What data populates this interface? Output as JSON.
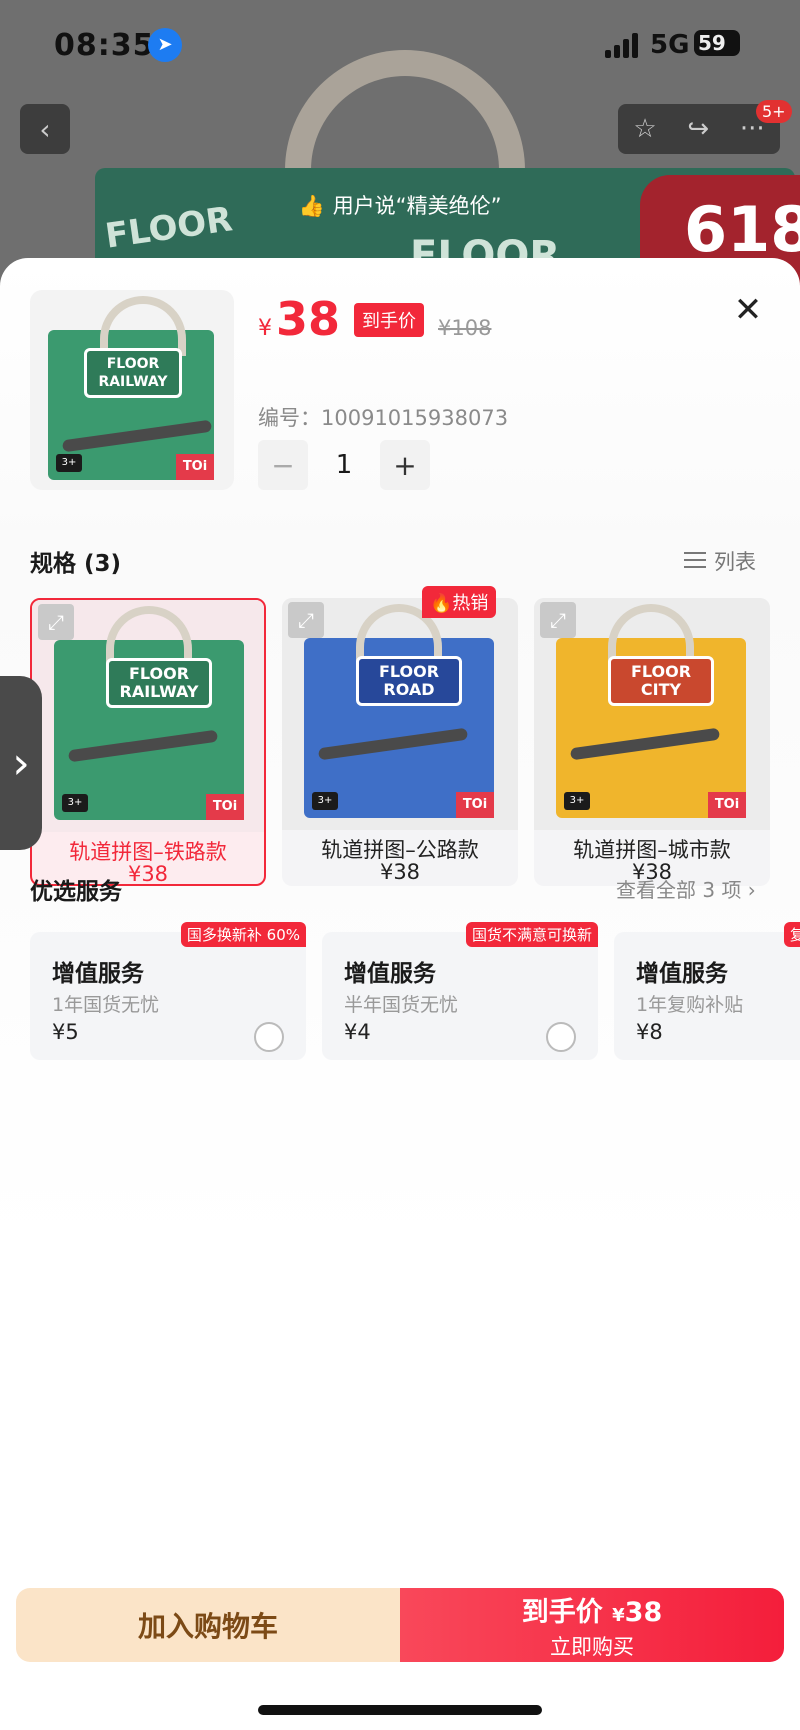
{
  "status_bar": {
    "time": "08:35",
    "network": "5G",
    "battery": "59"
  },
  "background": {
    "review_text": "用户说“精美绝伦”",
    "notification_badge": "5+",
    "promo_badge": "618",
    "box_title": "FLOOR"
  },
  "product": {
    "currency": "¥",
    "price": "38",
    "price_tag": "到手价",
    "original_price": "¥108",
    "sku_label": "编号：",
    "sku_value": "10091015938073",
    "quantity": "1",
    "minus_label": "−",
    "plus_label": "+"
  },
  "specs": {
    "title": "规格 (3)",
    "view_toggle": "列表",
    "hot_badge": "热销",
    "variants": [
      {
        "name": "轨道拼图–铁路款",
        "price": "¥38",
        "box_label": "FLOOR RAILWAY",
        "color": "#3b9a6f",
        "selected": true
      },
      {
        "name": "轨道拼图–公路款",
        "price": "¥38",
        "box_label": "FLOOR ROAD",
        "color": "#3f6fc7",
        "selected": false
      },
      {
        "name": "轨道拼图–城市款",
        "price": "¥38",
        "box_label": "FLOOR CITY",
        "color": "#f0b52c",
        "selected": false
      }
    ],
    "box_brand": "TOi",
    "box_age": "3+"
  },
  "services": {
    "title": "优选服务",
    "view_all": "查看全部 3 项 ›",
    "items": [
      {
        "tag": "国多换新补 60%",
        "name": "增值服务",
        "desc": "1年国货无忧",
        "price": "¥5"
      },
      {
        "tag": "国货不满意可换新",
        "name": "增值服务",
        "desc": "半年国货无忧",
        "price": "¥4"
      },
      {
        "tag": "复",
        "name": "增值服务",
        "desc": "1年复购补贴",
        "price": "¥8"
      }
    ]
  },
  "actions": {
    "add_to_cart": "加入购物车",
    "buy_price_label": "到手价",
    "buy_currency": "¥",
    "buy_price": "38",
    "buy_now": "立即购买"
  },
  "colors": {
    "accent": "#f2283a",
    "cart_bg": "#fbe4c8",
    "cart_text": "#7c4a16"
  }
}
